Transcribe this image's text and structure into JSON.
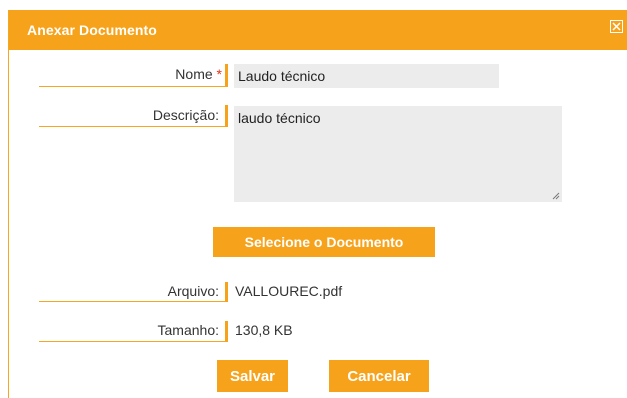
{
  "dialog": {
    "title": "Anexar Documento",
    "close_icon": "close-box-icon"
  },
  "form": {
    "nome_label": "Nome",
    "required_marker": "*",
    "nome_value": "Laudo técnico",
    "descricao_label": "Descrição:",
    "descricao_value": "laudo técnico",
    "select_document_label": "Selecione o Documento",
    "arquivo_label": "Arquivo:",
    "arquivo_value": "VALLOUREC.pdf",
    "tamanho_label": "Tamanho:",
    "tamanho_value": "130,8 KB"
  },
  "actions": {
    "save_label": "Salvar",
    "cancel_label": "Cancelar"
  },
  "colors": {
    "accent": "#f7a21b",
    "required": "#e0321b",
    "field_background": "#ececec"
  }
}
